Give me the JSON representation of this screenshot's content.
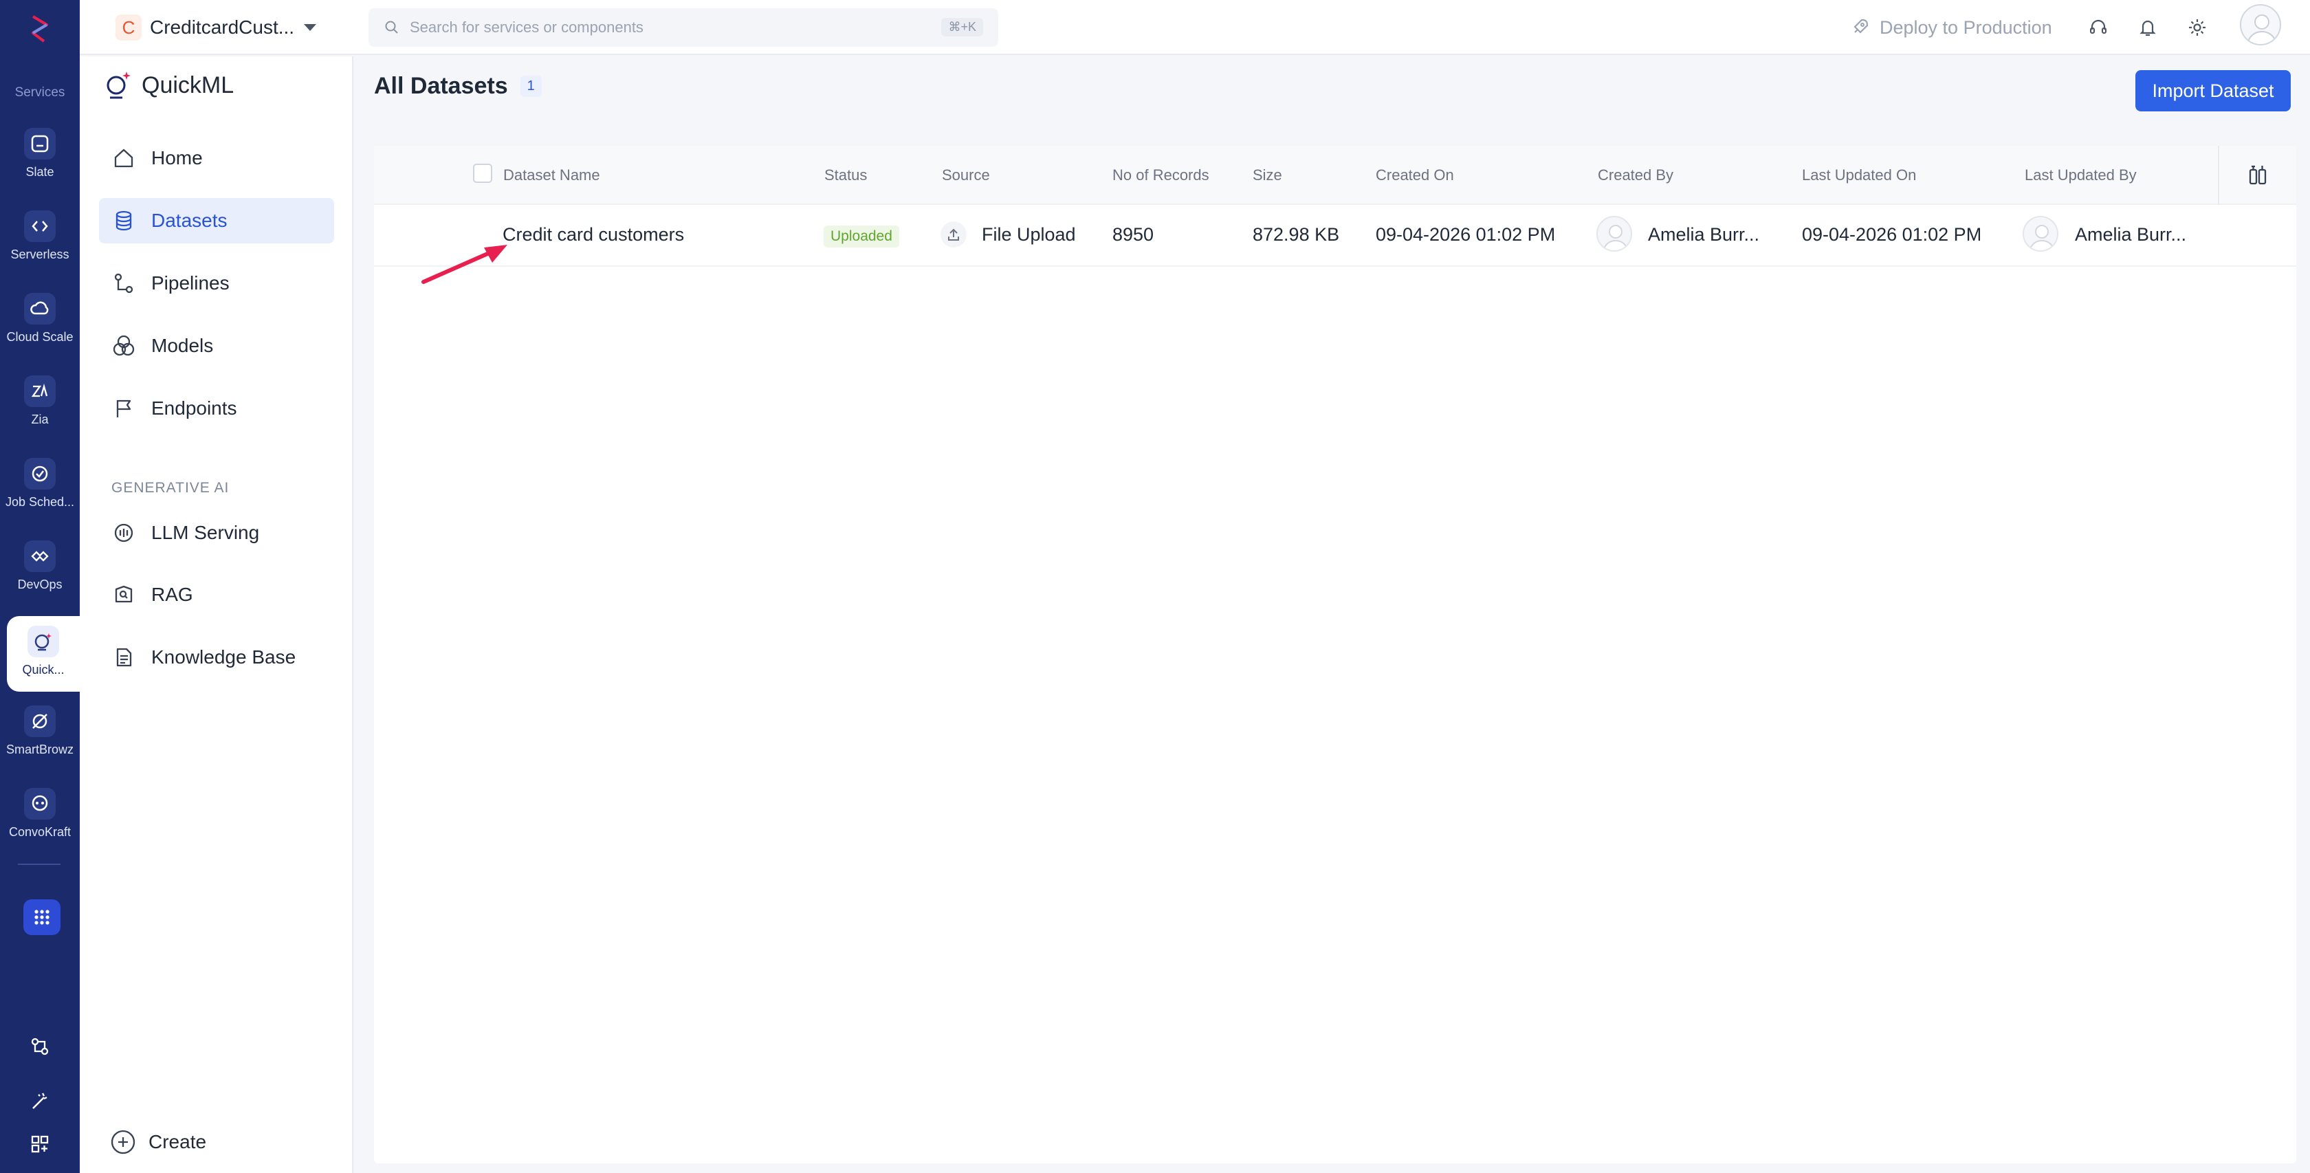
{
  "rail": {
    "section_label": "Services",
    "items": [
      {
        "label": "Slate",
        "icon": "slate-icon"
      },
      {
        "label": "Serverless",
        "icon": "code-icon"
      },
      {
        "label": "Cloud Scale",
        "icon": "cloud-icon"
      },
      {
        "label": "Zia",
        "icon": "zia-icon"
      },
      {
        "label": "Job Sched...",
        "icon": "scheduler-icon"
      },
      {
        "label": "DevOps",
        "icon": "devops-icon"
      },
      {
        "label": "Quick...",
        "icon": "quickml-icon"
      },
      {
        "label": "SmartBrowz",
        "icon": "browser-icon"
      },
      {
        "label": "ConvoKraft",
        "icon": "bot-icon"
      }
    ],
    "active_index": 6
  },
  "topbar": {
    "project_initial": "C",
    "project_name": "CreditcardCust...",
    "search_placeholder": "Search for services or components",
    "search_shortcut": "⌘+K",
    "deploy_label": "Deploy to Production"
  },
  "sidebar": {
    "brand": "QuickML",
    "items": [
      {
        "label": "Home",
        "icon": "home-icon"
      },
      {
        "label": "Datasets",
        "icon": "database-icon"
      },
      {
        "label": "Pipelines",
        "icon": "pipeline-icon"
      },
      {
        "label": "Models",
        "icon": "models-icon"
      },
      {
        "label": "Endpoints",
        "icon": "flag-icon"
      }
    ],
    "active_index": 1,
    "section_label": "GENERATIVE AI",
    "gen_items": [
      {
        "label": "LLM Serving",
        "icon": "llm-icon"
      },
      {
        "label": "RAG",
        "icon": "rag-icon"
      },
      {
        "label": "Knowledge Base",
        "icon": "document-icon"
      }
    ],
    "create_label": "Create"
  },
  "main": {
    "title": "All Datasets",
    "count": "1",
    "import_label": "Import Dataset"
  },
  "table": {
    "columns": [
      "Dataset Name",
      "Status",
      "Source",
      "No of Records",
      "Size",
      "Created On",
      "Created By",
      "Last Updated On",
      "Last Updated By"
    ],
    "rows": [
      {
        "name": "Credit card customers",
        "status": "Uploaded",
        "source": "File Upload",
        "records": "8950",
        "size": "872.98 KB",
        "created_on": "09-04-2026 01:02 PM",
        "created_by": "Amelia Burr...",
        "updated_on": "09-04-2026 01:02 PM",
        "updated_by": "Amelia Burr..."
      }
    ]
  },
  "colors": {
    "rail_bg": "#1a2a6b",
    "accent": "#2e62e6",
    "annotation_arrow": "#e8204f",
    "status_green": "#5fa52e"
  }
}
